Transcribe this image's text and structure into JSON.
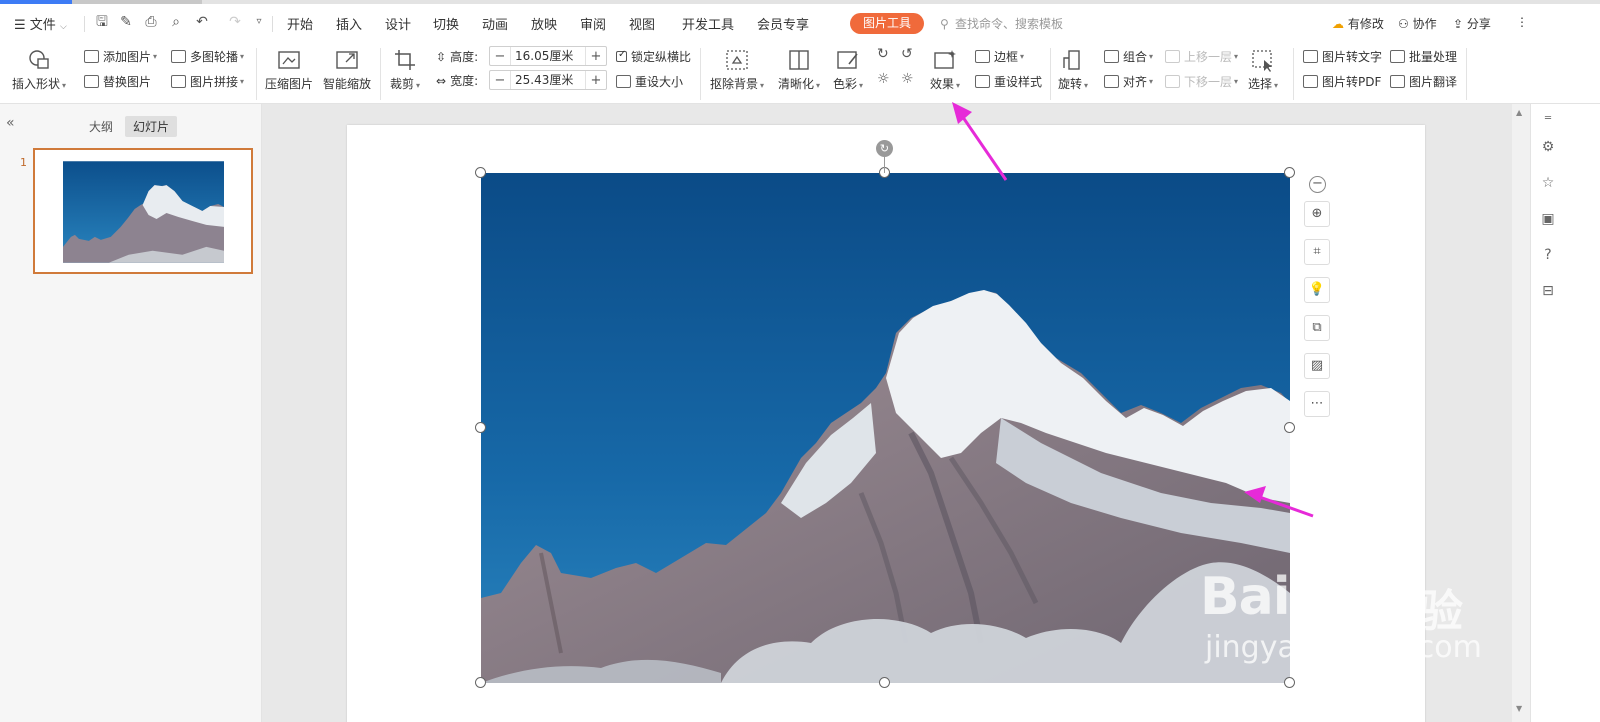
{
  "menu": {
    "file_label": "文件",
    "tabs": [
      "开始",
      "插入",
      "设计",
      "切换",
      "动画",
      "放映",
      "审阅",
      "视图",
      "开发工具",
      "会员专享"
    ],
    "active_tool_tab": "图片工具",
    "search_placeholder": "查找命令、搜索模板",
    "modify_label": "有修改",
    "collab_label": "协作",
    "share_label": "分享"
  },
  "ribbon": {
    "insert_shape": "插入形状",
    "add_picture": "添加图片",
    "replace_picture": "替换图片",
    "multi_carousel": "多图轮播",
    "picture_stitch": "图片拼接",
    "compress": "压缩图片",
    "smart_zoom": "智能缩放",
    "crop": "裁剪",
    "height_label": "高度:",
    "height_value": "16.05厘米",
    "width_label": "宽度:",
    "width_value": "25.43厘米",
    "lock_ratio": "锁定纵横比",
    "reset_size": "重设大小",
    "remove_bg": "抠除背景",
    "sharpen": "清晰化",
    "color": "色彩",
    "effects": "效果",
    "border": "边框",
    "reset_style": "重设样式",
    "rotate": "旋转",
    "group": "组合",
    "align": "对齐",
    "bring_forward": "上移一层",
    "send_backward": "下移一层",
    "select": "选择",
    "pic_to_text": "图片转文字",
    "pic_to_pdf": "图片转PDF",
    "batch_process": "批量处理",
    "pic_translate": "图片翻译"
  },
  "left_panel": {
    "tab_outline": "大纲",
    "tab_slides": "幻灯片",
    "slide_number": "1"
  },
  "watermark": {
    "brand": "Bai",
    "brand2": "经验",
    "url": "jingyan.baidu.com"
  },
  "colors": {
    "accent": "#f06a3b",
    "sky_top": "#0c4f8c",
    "sky_bottom": "#1d76b3",
    "arrow": "#e62ad8"
  }
}
